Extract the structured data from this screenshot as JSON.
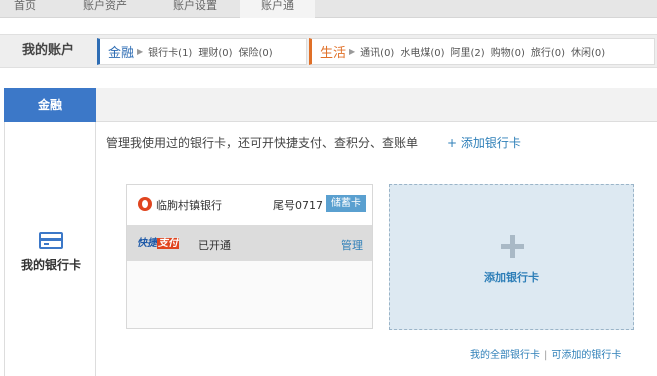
{
  "top_tabs": [
    {
      "label": "首页"
    },
    {
      "label": "账户资产"
    },
    {
      "label": "账户设置"
    },
    {
      "label": "账户通"
    }
  ],
  "account_bar": {
    "title": "我的账户",
    "finance": {
      "name": "金融",
      "items": [
        "银行卡(1)",
        "理财(0)",
        "保险(0)"
      ]
    },
    "life": {
      "name": "生活",
      "items": [
        "通讯(0)",
        "水电煤(0)",
        "阿里(2)",
        "购物(0)",
        "旅行(0)",
        "休闲(0)"
      ]
    }
  },
  "left_nav": {
    "active": "金融",
    "card_label": "我的银行卡"
  },
  "content": {
    "intro": "管理我使用过的银行卡，还可开快捷支付、查积分、查账单",
    "add_link": "+ 添加银行卡",
    "bank_card": {
      "bank_name": "临朐村镇银行",
      "tail_number": "尾号0717",
      "card_type": "储蓄卡",
      "quick_pay_logo_a": "快捷",
      "quick_pay_logo_b": "支付",
      "quick_pay_status": "已开通",
      "manage": "管理"
    },
    "add_card_label": "添加银行卡",
    "footer_links": [
      "我的全部银行卡",
      "可添加的银行卡"
    ]
  },
  "colors": {
    "finance_accent": "#2e6db4",
    "life_accent": "#e07028",
    "link": "#2e7fb8",
    "nav_active": "#3c78c8"
  },
  "icons": [
    "bank-card-icon",
    "bank-logo-icon",
    "plus-icon"
  ]
}
